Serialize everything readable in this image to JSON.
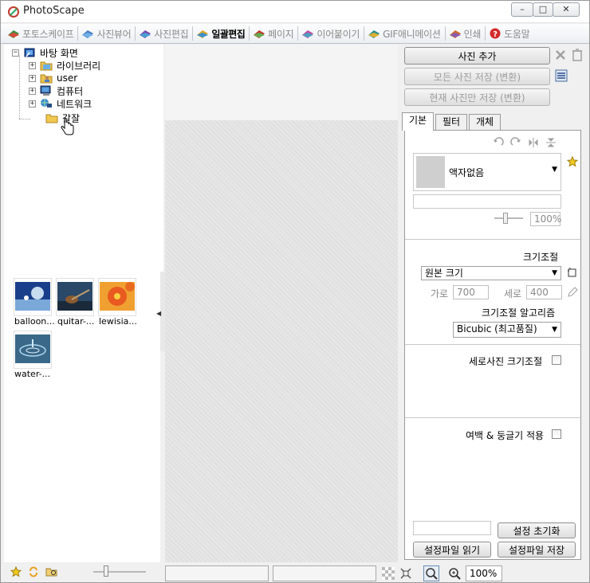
{
  "window": {
    "title": "PhotoScape",
    "minimize_label": "–",
    "maximize_label": "□",
    "close_label": "✕"
  },
  "tabs": [
    {
      "label": "포토스케이프"
    },
    {
      "label": "사진뷰어"
    },
    {
      "label": "사진편집"
    },
    {
      "label": "일괄편집",
      "active": true
    },
    {
      "label": "페이지"
    },
    {
      "label": "이어붙이기"
    },
    {
      "label": "GIF애니메이션"
    },
    {
      "label": "인쇄"
    },
    {
      "label": "도움말"
    }
  ],
  "tree": {
    "root": "바탕 화면",
    "items": [
      {
        "label": "라이브러리"
      },
      {
        "label": "user"
      },
      {
        "label": "컴퓨터"
      },
      {
        "label": "네트워크"
      },
      {
        "label": "갈잘"
      }
    ],
    "expander_collapsed": "+",
    "expander_expanded": "−"
  },
  "thumbnails": [
    {
      "caption": "balloon..."
    },
    {
      "caption": "quitar-..."
    },
    {
      "caption": "lewisia..."
    },
    {
      "caption": "water-..."
    }
  ],
  "status": {
    "zoom": "100%"
  },
  "right": {
    "add_photo": "사진 추가",
    "save_all": "모든 사진 저장 (변환)",
    "save_current": "현재 사진만 저장 (변환)",
    "subtabs": [
      "기본",
      "필터",
      "개체"
    ],
    "frame_select": "액자없음",
    "frame_zoom": "100%",
    "resize_title": "크기조절",
    "resize_select": "원본 크기",
    "width_label": "가로",
    "width_value": "700",
    "height_label": "세로",
    "height_value": "400",
    "algorithm_title": "크기조절 알고리즘",
    "algorithm_select": "Bicubic (최고품질)",
    "portrait_resize": "세로사진 크기조절",
    "margin_round": "여백 & 둥글기 적용",
    "reset_settings": "설정 초기화",
    "load_settings": "설정파일 읽기",
    "save_settings": "설정파일 저장"
  },
  "colors": {
    "accent": "#3a6ea5",
    "preview_bg": "#e6e6e6"
  }
}
